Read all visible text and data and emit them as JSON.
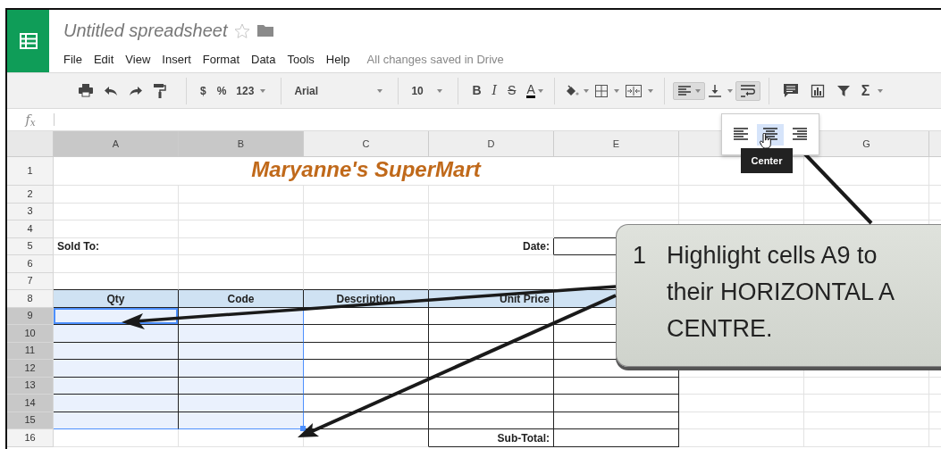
{
  "app": {
    "title": "Untitled spreadsheet",
    "starred": false,
    "menus": [
      "File",
      "Edit",
      "View",
      "Insert",
      "Format",
      "Data",
      "Tools",
      "Help"
    ],
    "save_status": "All changes saved in Drive"
  },
  "toolbar": {
    "number_buttons": [
      "$",
      "%"
    ],
    "number_format": "123",
    "font": "Arial",
    "font_size": "10",
    "style_buttons": [
      "B",
      "I",
      "S",
      "A"
    ],
    "align_pressed": true,
    "wrap_pressed": true,
    "functions": "Σ"
  },
  "formula_bar": {
    "label": "f$_{x}$"
  },
  "align_menu": {
    "options": [
      {
        "selected": false
      },
      {
        "selected": true
      },
      {
        "selected": false
      }
    ],
    "tooltip": "Center"
  },
  "sheet": {
    "columns": [
      {
        "label": "A",
        "selected": true
      },
      {
        "label": "B",
        "selected": true
      },
      {
        "label": "C",
        "selected": false
      },
      {
        "label": "D",
        "selected": false
      },
      {
        "label": "E",
        "selected": false
      },
      {
        "selected": false
      },
      {
        "label": "G",
        "selected": false
      }
    ],
    "rows": [
      {
        "label": "1",
        "kind": "title",
        "selected": false,
        "title": "Maryanne's SuperMart"
      },
      {
        "label": "2",
        "kind": "plain",
        "selected": false
      },
      {
        "label": "3",
        "kind": "plain",
        "selected": false
      },
      {
        "label": "4",
        "kind": "plain",
        "selected": false
      },
      {
        "label": "5",
        "kind": "plain",
        "selected": false,
        "cells": {
          "A": {
            "text": "Sold To:",
            "kind": "label"
          },
          "D": {
            "text": "Date:",
            "kind": "field-label"
          },
          "E": {
            "boxed": true
          }
        }
      },
      {
        "label": "6",
        "kind": "plain",
        "selected": false
      },
      {
        "label": "7",
        "kind": "plain",
        "selected": false
      },
      {
        "label": "8",
        "kind": "header",
        "selected": false,
        "cells": {
          "A": {
            "text": "Qty",
            "kind": "heading"
          },
          "B": {
            "text": "Code",
            "kind": "heading"
          },
          "C": {
            "text": "Description",
            "kind": "heading"
          },
          "D": {
            "text": "Unit Price",
            "kind": "field-label"
          }
        }
      },
      {
        "label": "9",
        "kind": "line",
        "selected": true,
        "cells": {
          "A": {
            "active": true
          }
        }
      },
      {
        "label": "10",
        "kind": "line",
        "selected": true
      },
      {
        "label": "11",
        "kind": "line",
        "selected": true
      },
      {
        "label": "12",
        "kind": "line",
        "selected": true
      },
      {
        "label": "13",
        "kind": "line",
        "selected": true
      },
      {
        "label": "14",
        "kind": "line",
        "selected": true
      },
      {
        "label": "15",
        "kind": "line",
        "selected": true
      },
      {
        "label": "16",
        "kind": "plain",
        "selected": false,
        "cells": {
          "D": {
            "text": "Sub-Total:",
            "kind": "field-label",
            "boxed": true
          },
          "E": {
            "boxed": true
          }
        }
      }
    ]
  },
  "callout": {
    "number": "1",
    "lines": [
      "Highlight cells A9 to",
      "their HORIZONTAL A",
      "CENTRE."
    ]
  }
}
